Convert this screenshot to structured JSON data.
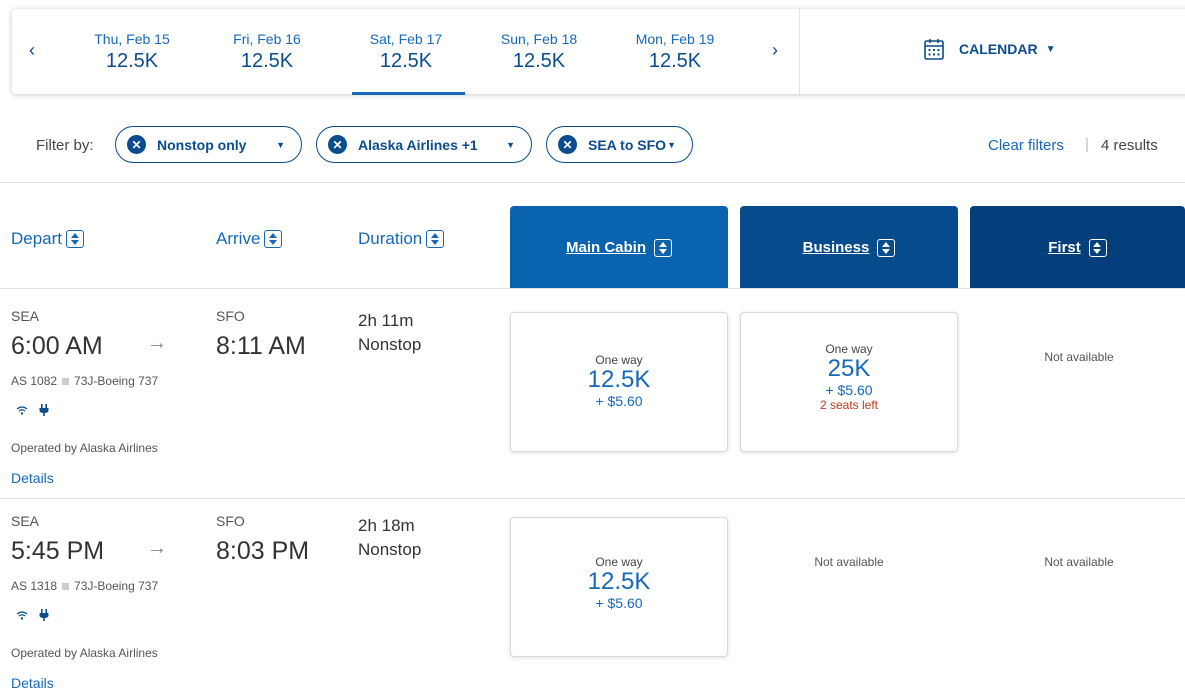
{
  "date_strip": {
    "prev_icon": "chevron-left-icon",
    "next_icon": "chevron-right-icon",
    "dates": [
      {
        "day": "Thu, Feb 15",
        "points": "12.5K",
        "selected": false
      },
      {
        "day": "Fri, Feb 16",
        "points": "12.5K",
        "selected": false
      },
      {
        "day": "Sat, Feb 17",
        "points": "12.5K",
        "selected": true
      },
      {
        "day": "Sun, Feb 18",
        "points": "12.5K",
        "selected": false
      },
      {
        "day": "Mon, Feb 19",
        "points": "12.5K",
        "selected": false
      }
    ],
    "calendar_label": "CALENDAR",
    "calendar_icon": "calendar-icon"
  },
  "filters": {
    "label": "Filter by:",
    "chips": [
      {
        "label": "Nonstop only"
      },
      {
        "label": "Alaska Airlines +1"
      },
      {
        "label": "SEA to SFO"
      }
    ],
    "clear_label": "Clear filters",
    "separator": "|",
    "results_label": "4 results"
  },
  "columns": {
    "depart": "Depart",
    "arrive": "Arrive",
    "duration": "Duration",
    "cabins": [
      {
        "label": "Main Cabin",
        "color": "#0a63ae"
      },
      {
        "label": "Business",
        "color": "#064b8c"
      },
      {
        "label": "First",
        "color": "#043f7c"
      }
    ]
  },
  "flights": [
    {
      "from_code": "SEA",
      "depart_time": "6:00 AM",
      "to_code": "SFO",
      "arrive_time": "8:11 AM",
      "duration": "2h 11m",
      "stops": "Nonstop",
      "flight_number": "AS 1082",
      "aircraft": "73J-Boeing 737",
      "amenities": [
        "wifi-icon",
        "power-outlet-icon"
      ],
      "operated_by": "Operated by Alaska Airlines",
      "details_label": "Details",
      "main": {
        "label": "One way",
        "points": "12.5K",
        "tax": "+ $5.60"
      },
      "business": {
        "label": "One way",
        "points": "25K",
        "tax": "+ $5.60",
        "seats": "2 seats left"
      },
      "first": {
        "na": "Not available"
      }
    },
    {
      "from_code": "SEA",
      "depart_time": "5:45 PM",
      "to_code": "SFO",
      "arrive_time": "8:03 PM",
      "duration": "2h 18m",
      "stops": "Nonstop",
      "flight_number": "AS 1318",
      "aircraft": "73J-Boeing 737",
      "amenities": [
        "wifi-icon",
        "power-outlet-icon"
      ],
      "operated_by": "Operated by Alaska Airlines",
      "details_label": "Details",
      "main": {
        "label": "One way",
        "points": "12.5K",
        "tax": "+ $5.60"
      },
      "business": {
        "na": "Not available"
      },
      "first": {
        "na": "Not available"
      }
    }
  ]
}
